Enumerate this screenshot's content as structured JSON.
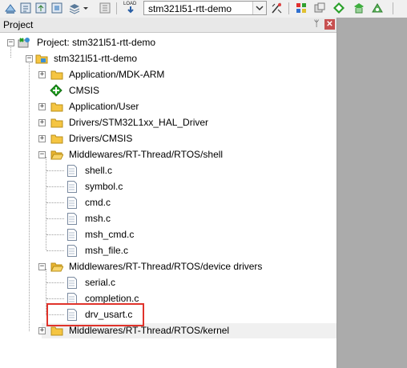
{
  "toolbar": {
    "target_select": "stm321l51-rtt-demo",
    "load_label": "Load",
    "icons": [
      "translate-icon",
      "build-icon",
      "rebuild-icon",
      "batch-build-icon",
      "dropdown-arrow-icon",
      "download-icon",
      "load-icon",
      "target-options-icon",
      "manage-components-icon",
      "pack-installer-icon",
      "select-packs-icon",
      "runtime-env-icon"
    ]
  },
  "panel": {
    "title": "Project",
    "pin": "ᛘ",
    "close": "✕"
  },
  "tree": {
    "project": "Project: stm321l51-rtt-demo",
    "target": "stm321l51-rtt-demo",
    "groups": {
      "app_mdk": "Application/MDK-ARM",
      "cmsis": "CMSIS",
      "app_user": "Application/User",
      "drivers_hal": "Drivers/STM32L1xx_HAL_Driver",
      "drivers_cmsis": "Drivers/CMSIS",
      "mw_shell": "Middlewares/RT-Thread/RTOS/shell",
      "mw_devdrv": "Middlewares/RT-Thread/RTOS/device drivers",
      "mw_kernel": "Middlewares/RT-Thread/RTOS/kernel"
    },
    "shell_files": [
      "shell.c",
      "symbol.c",
      "cmd.c",
      "msh.c",
      "msh_cmd.c",
      "msh_file.c"
    ],
    "devdrv_files": [
      "serial.c",
      "completion.c",
      "drv_usart.c"
    ]
  },
  "colors": {
    "highlight_box": "#e0332b",
    "folder": "#f5c542",
    "cmsis_diamond": "#22a022"
  }
}
